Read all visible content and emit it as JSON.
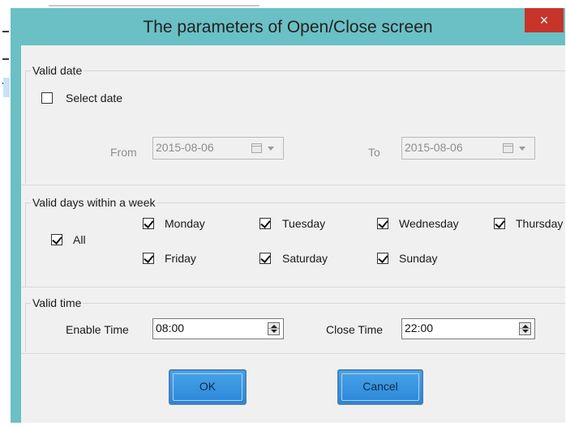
{
  "dialog": {
    "title": "The parameters of Open/Close screen",
    "close_label": "×"
  },
  "valid_date": {
    "group_title": "Valid date",
    "select_date_label": "Select date",
    "select_date_checked": false,
    "from_label": "From",
    "from_value": "2015-08-06",
    "to_label": "To",
    "to_value": "2015-08-06"
  },
  "valid_days": {
    "group_title": "Valid days within a week",
    "all_label": "All",
    "days": [
      {
        "label": "Monday",
        "checked": true
      },
      {
        "label": "Tuesday",
        "checked": true
      },
      {
        "label": "Wednesday",
        "checked": true
      },
      {
        "label": "Thursday",
        "checked": true
      },
      {
        "label": "Friday",
        "checked": true
      },
      {
        "label": "Saturday",
        "checked": true
      },
      {
        "label": "Sunday",
        "checked": true
      }
    ]
  },
  "valid_time": {
    "group_title": "Valid time",
    "enable_label": "Enable Time",
    "enable_value": "08:00",
    "close_label": "Close Time",
    "close_value": "22:00"
  },
  "buttons": {
    "ok_label": "OK",
    "cancel_label": "Cancel"
  },
  "colors": {
    "frame": "#6ac0c4",
    "close_button": "#c7342a",
    "button_blue": "#2a86d8"
  }
}
